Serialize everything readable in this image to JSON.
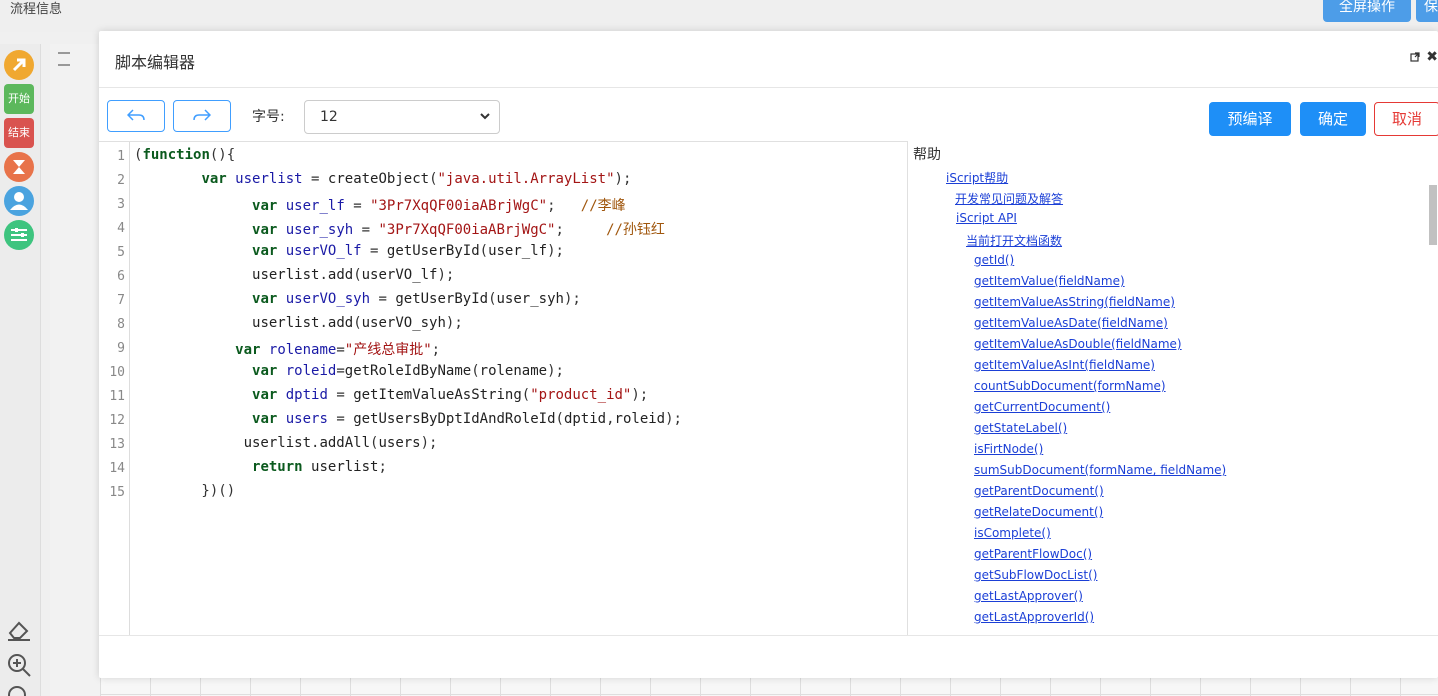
{
  "background": {
    "title": "流程信息",
    "fullscreen_label": "全屏操作",
    "save_label": "保",
    "tools": [
      {
        "name": "arrow-tool",
        "color": "#f0a030"
      },
      {
        "name": "start-node",
        "label": "开始",
        "color": "#5cb85c"
      },
      {
        "name": "end-node",
        "label": "结束",
        "color": "#d9534f"
      },
      {
        "name": "auto-node",
        "color": "#e8734a"
      },
      {
        "name": "user-node",
        "color": "#4aa3df"
      },
      {
        "name": "gateway-node",
        "color": "#3ec47f"
      }
    ]
  },
  "dialog": {
    "title": "脚本编辑器",
    "font_size_label": "字号:",
    "font_size_value": "12",
    "precompile_label": "预编译",
    "confirm_label": "确定",
    "cancel_label": "取消"
  },
  "editor": {
    "line_numbers": [
      "1",
      "2",
      "3",
      "4",
      "5",
      "6",
      "7",
      "8",
      "9",
      "10",
      "11",
      "12",
      "13",
      "14",
      "15"
    ],
    "lines": [
      "(function(){",
      "        var userlist = createObject(\"java.util.ArrayList\");",
      "              var user_lf = \"3Pr7XqQF00iaABrjWgC\";   //李峰",
      "              var user_syh = \"3Pr7XqQF00iaABrjWgC\";     //孙钰红",
      "              var userVO_lf = getUserById(user_lf);",
      "              userlist.add(userVO_lf);",
      "              var userVO_syh = getUserById(user_syh);",
      "              userlist.add(userVO_syh);",
      "            var rolename=\"产线总审批\";",
      "              var roleid=getRoleIdByName(rolename);",
      "              var dptid = getItemValueAsString(\"product_id\");",
      "              var users = getUsersByDptIdAndRoleId(dptid,roleid);",
      "             userlist.addAll(users);",
      "              return userlist;",
      "        })()"
    ]
  },
  "help": {
    "title": "帮助",
    "items": [
      {
        "label": "iScript帮助",
        "level": 0
      },
      {
        "label": "开发常见问题及解答",
        "level": 1
      },
      {
        "label": "iScript API",
        "level": 1
      },
      {
        "label": "当前打开文档函数",
        "level": 2
      },
      {
        "label": "getId()",
        "level": 3
      },
      {
        "label": "getItemValue(fieldName)",
        "level": 3
      },
      {
        "label": "getItemValueAsString(fieldName)",
        "level": 3
      },
      {
        "label": "getItemValueAsDate(fieldName)",
        "level": 3
      },
      {
        "label": "getItemValueAsDouble(fieldName)",
        "level": 3
      },
      {
        "label": "getItemValueAsInt(fieldName)",
        "level": 3
      },
      {
        "label": "countSubDocument(formName)",
        "level": 3
      },
      {
        "label": "getCurrentDocument()",
        "level": 3
      },
      {
        "label": "getStateLabel()",
        "level": 3
      },
      {
        "label": "isFirtNode()",
        "level": 3
      },
      {
        "label": "sumSubDocument(formName, fieldName)",
        "level": 3
      },
      {
        "label": "getParentDocument()",
        "level": 3
      },
      {
        "label": "getRelateDocument()",
        "level": 3
      },
      {
        "label": "isComplete()",
        "level": 3
      },
      {
        "label": "getParentFlowDoc()",
        "level": 3
      },
      {
        "label": "getSubFlowDocList()",
        "level": 3
      },
      {
        "label": "getLastApprover()",
        "level": 3
      },
      {
        "label": "getLastApproverId()",
        "level": 3
      }
    ]
  }
}
